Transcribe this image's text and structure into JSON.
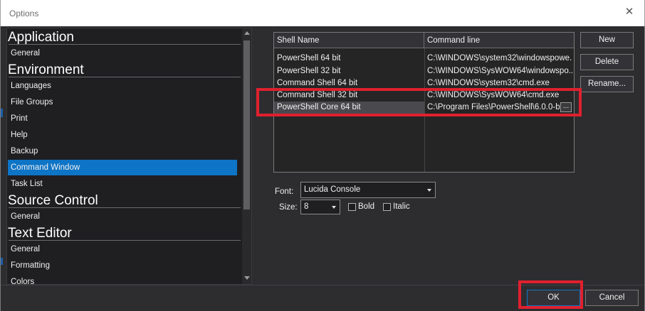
{
  "window": {
    "title": "Options",
    "close_glyph": "✕"
  },
  "sidebar": {
    "categories": [
      {
        "label": "Application",
        "items": [
          "General"
        ]
      },
      {
        "label": "Environment",
        "items": [
          "Languages",
          "File Groups",
          "Print",
          "Help",
          "Backup",
          "Command Window",
          "Task List"
        ]
      },
      {
        "label": "Source Control",
        "items": [
          "General"
        ]
      },
      {
        "label": "Text Editor",
        "items": [
          "General",
          "Formatting",
          "Colors"
        ]
      }
    ],
    "selected_item": "Command Window"
  },
  "shells": {
    "columns": [
      "Shell Name",
      "Command line"
    ],
    "rows": [
      {
        "name": "PowerShell 64 bit",
        "command": "C:\\WINDOWS\\system32\\windowspowe..."
      },
      {
        "name": "PowerShell 32 bit",
        "command": "C:\\WINDOWS\\SysWOW64\\windowspo..."
      },
      {
        "name": "Command Shell 64 bit",
        "command": "C:\\WINDOWS\\system32\\cmd.exe"
      },
      {
        "name": "Command Shell 32 bit",
        "command": "C:\\WINDOWS\\SysWOW64\\cmd.exe"
      },
      {
        "name": "PowerShell Core 64 bit",
        "command": "C:\\Program Files\\PowerShell\\6.0.0-b..."
      }
    ],
    "selected_row": "PowerShell Core 64 bit",
    "browse_label": "..."
  },
  "actions": {
    "new_label": "New",
    "delete_label": "Delete",
    "rename_label": "Rename..."
  },
  "font_settings": {
    "font_label": "Font:",
    "font_value": "Lucida Console",
    "size_label": "Size:",
    "size_value": "8",
    "bold_label": "Bold",
    "bold_checked": false,
    "italic_label": "Italic",
    "italic_checked": false
  },
  "footer": {
    "ok_label": "OK",
    "cancel_label": "Cancel"
  },
  "colors": {
    "dialog_bg": "#2d2d30",
    "selection": "#0e74c6",
    "highlight": "#e0202e"
  }
}
